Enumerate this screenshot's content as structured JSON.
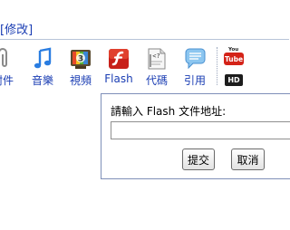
{
  "header": {
    "link_text": "[修改]"
  },
  "toolbar": {
    "items": [
      {
        "label": "附件",
        "icon": "paperclip-icon"
      },
      {
        "label": "音樂",
        "icon": "music-note-icon"
      },
      {
        "label": "視頻",
        "icon": "tv-icon"
      },
      {
        "label": "Flash",
        "icon": "flash-icon"
      },
      {
        "label": "代碼",
        "icon": "code-icon"
      },
      {
        "label": "引用",
        "icon": "quote-icon"
      }
    ],
    "youtube_text": "You Tube",
    "hd_text": "HD"
  },
  "flash_dialog": {
    "prompt": "請輸入 Flash 文件地址:",
    "url_value": "",
    "submit_label": "提交",
    "cancel_label": "取消"
  },
  "colors": {
    "link": "#1a3db3",
    "dialog_border": "#7f8fb8"
  }
}
